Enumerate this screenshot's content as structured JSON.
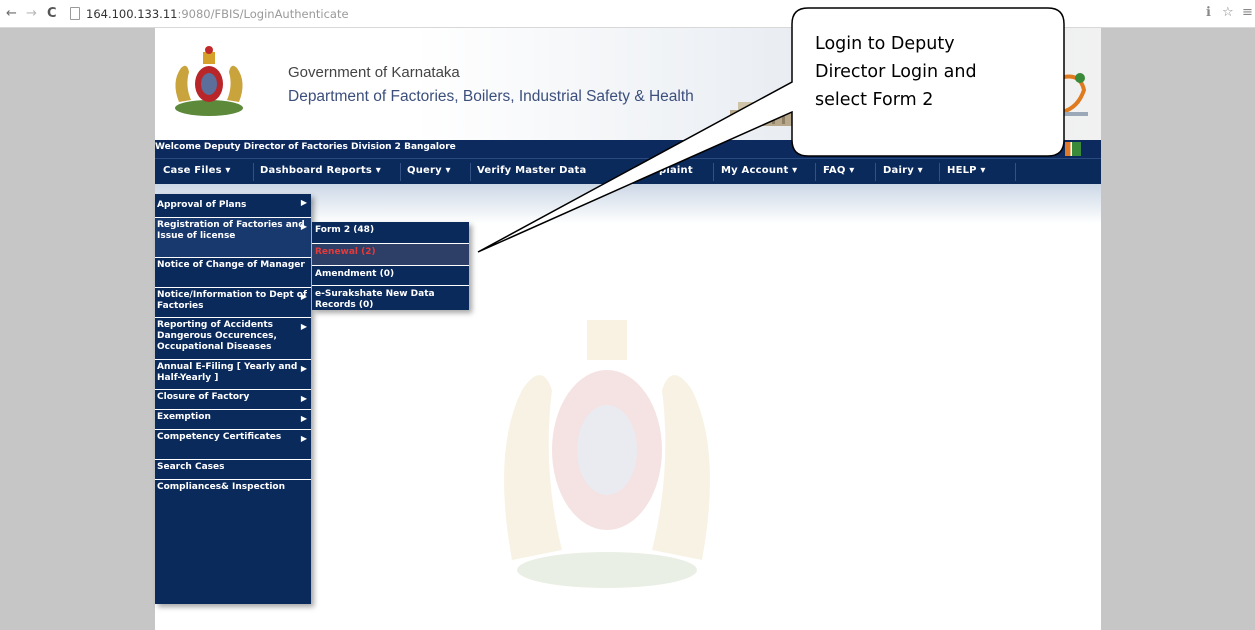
{
  "browser": {
    "url_host": "164.100.133.11",
    "url_path": ":9080/FBIS/LoginAuthenticate",
    "back_icon": "←",
    "forward_icon": "→",
    "reload_icon": "C",
    "right_icons": [
      "ℹ",
      "☆",
      "≡"
    ]
  },
  "header": {
    "gov_line": "Government of Karnataka",
    "dept_line": "Department of Factories, Boilers, Industrial Safety & Health",
    "welcome": "Welcome Deputy Director of Factories Division 2 Bangalore"
  },
  "menubar": {
    "items": [
      "Case Files ▾",
      "Dashboard Reports ▾",
      "Query ▾",
      "Verify Master Data",
      "plaint",
      "My Account ▾",
      "FAQ ▾",
      "Dairy ▾",
      "HELP ▾"
    ]
  },
  "case_files_menu": {
    "items": [
      "Approval of Plans",
      "Registration of Factories and Issue of license",
      "Notice of Change of Manager",
      "Notice/Information to Dept of Factories",
      "Reporting of Accidents Dangerous Occurences, Occupational Diseases",
      "Annual E-Filing [ Yearly and Half-Yearly ]",
      "Closure of Factory",
      "Exemption",
      "Competency Certificates",
      "Search Cases",
      "Compliances& Inspection"
    ]
  },
  "registration_submenu": {
    "items": [
      "Form 2 (48)",
      "Renewal (2)",
      "Amendment (0)",
      "e-Surakshate New Data Records (0)"
    ]
  },
  "callout": {
    "lines": [
      "Login to Deputy",
      "Director Login and",
      "select Form 2"
    ]
  },
  "colors": {
    "navy": "#0b2a5c",
    "renewal_red": "#e53a3a"
  }
}
